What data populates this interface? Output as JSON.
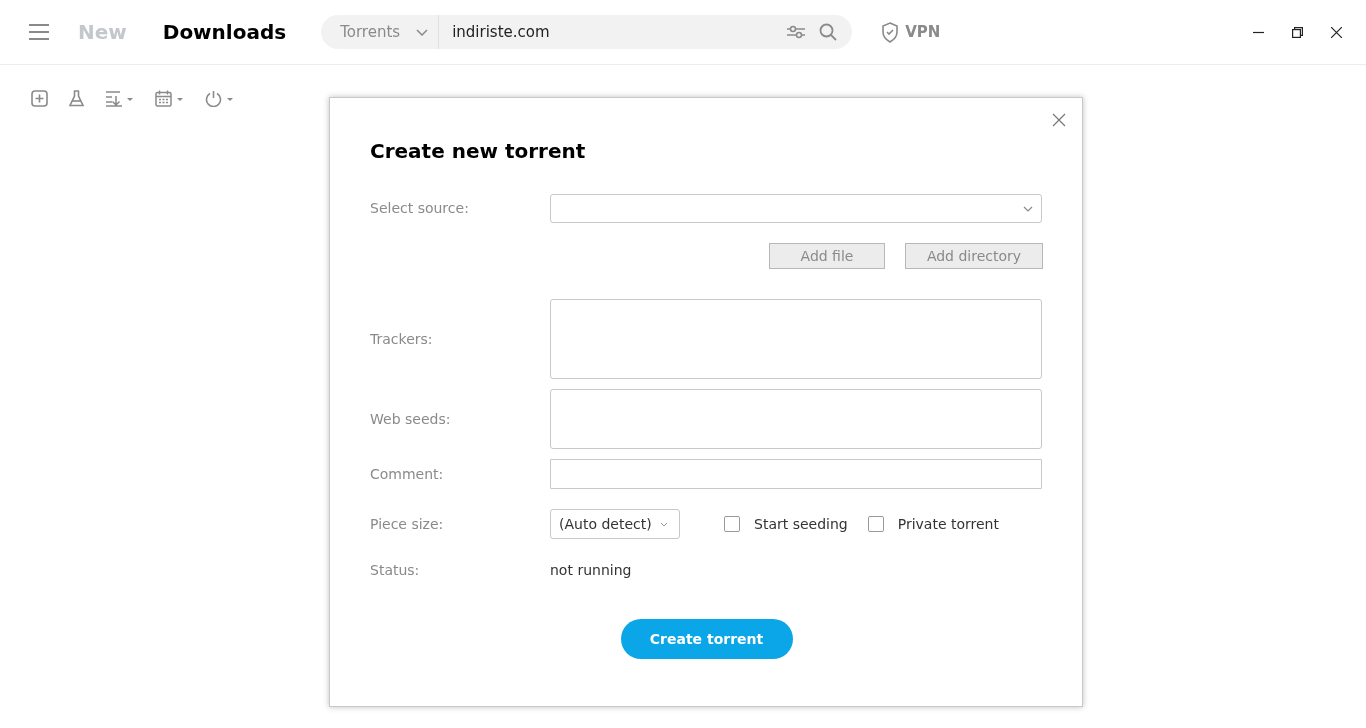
{
  "header": {
    "tabs": [
      {
        "label": "New",
        "selected": false
      },
      {
        "label": "Downloads",
        "selected": true
      }
    ],
    "search": {
      "scope": "Torrents",
      "value": "indiriste.com"
    },
    "vpn": "VPN"
  },
  "dialog": {
    "title": "Create new torrent",
    "select_source": {
      "label": "Select source:"
    },
    "buttons": [
      "Add file",
      "Add directory"
    ],
    "trackers": {
      "label": "Trackers:"
    },
    "web_seeds": {
      "label": "Web seeds:"
    },
    "comment": {
      "label": "Comment:"
    },
    "piece_size": {
      "label": "Piece size:",
      "value": "(Auto detect)"
    },
    "options": [
      {
        "label": "Start seeding",
        "checked": false
      },
      {
        "label": "Private torrent",
        "checked": false
      }
    ],
    "status": {
      "label": "Status:",
      "value": "not running"
    },
    "submit": "Create torrent"
  }
}
